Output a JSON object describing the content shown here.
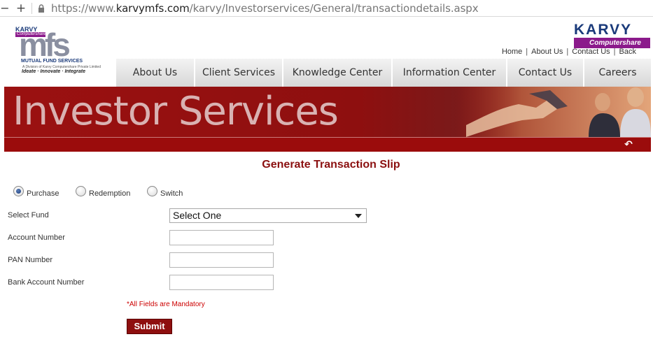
{
  "browser": {
    "url_prefix": "https://www.",
    "url_host": "karvymfs.com",
    "url_path": "/karvy/Investorservices/General/transactiondetails.aspx"
  },
  "logo_left": {
    "karvy": "KARVY",
    "computershare": "Computershare",
    "mfs": "mfs",
    "subtitle": "MUTUAL FUND SERVICES",
    "division": "A Division of Karvy Computershare Private Limited",
    "tagline": "Ideate · Innovate · Integrate"
  },
  "logo_right": {
    "karvy": "KARVY",
    "computershare": "Computershare"
  },
  "top_links": [
    "Home",
    "About Us",
    "Contact Us",
    "Back"
  ],
  "nav_tabs": [
    "About Us",
    "Client Services",
    "Knowledge Center",
    "Information Center",
    "Contact Us",
    "Careers"
  ],
  "banner": {
    "title": "Investor Services"
  },
  "form": {
    "title": "Generate Transaction Slip",
    "radios": [
      {
        "label": "Purchase",
        "checked": true
      },
      {
        "label": "Redemption",
        "checked": false
      },
      {
        "label": "Switch",
        "checked": false
      }
    ],
    "fields": {
      "select_fund_label": "Select Fund",
      "select_fund_value": "Select One",
      "account_number_label": "Account Number",
      "pan_number_label": "PAN Number",
      "bank_account_label": "Bank Account Number"
    },
    "mandatory_note": "*All Fields are Mandatory",
    "submit_label": "Submit"
  }
}
